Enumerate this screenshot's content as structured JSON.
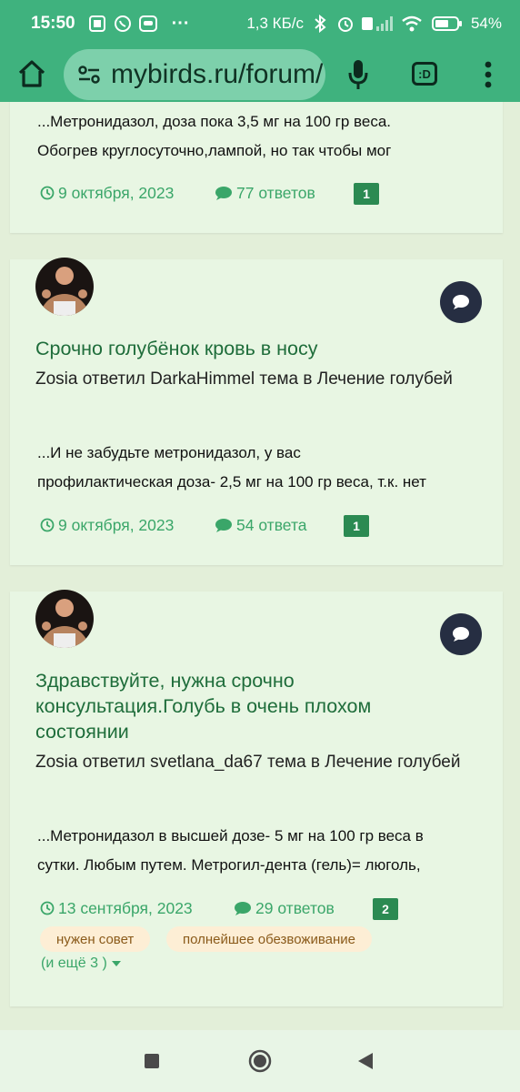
{
  "status_bar": {
    "time": "15:50",
    "speed": "1,3 КБ/с",
    "battery": "54%",
    "more": "···"
  },
  "browser": {
    "url": "mybirds.ru/forum/",
    "extension_label": ":D"
  },
  "posts": [
    {
      "snippet_lines": [
        "...Метронидазол, доза пока 3,5 мг на 100 гр веса.",
        "Обогрев круглосуточно,лампой, но так чтобы мог"
      ],
      "date": "9 октября, 2023",
      "replies": "77 ответов",
      "count": "1"
    },
    {
      "title": "Срочно голубёнок кровь в носу",
      "meta": "Zosia ответил DarkaHimmel тема в Лечение голубей",
      "snippet_lines": [
        "...И не забудьте метронидазол, у вас",
        "профилактическая доза- 2,5 мг на 100 гр веса, т.к. нет"
      ],
      "date": "9 октября, 2023",
      "replies": "54 ответа",
      "count": "1"
    },
    {
      "title": "Здравствуйте, нужна срочно консультация.Голубь в очень плохом состоянии",
      "meta": "Zosia ответил svetlana_da67 тема в Лечение голубей",
      "snippet_lines": [
        "...Метронидазол в высшей дозе- 5 мг на 100 гр веса в",
        "сутки. Любым путем. Метрогил-дента (гель)= люголь,"
      ],
      "date": "13 сентября, 2023",
      "replies": "29 ответов",
      "count": "2",
      "tags": [
        "нужен совет",
        "полнейшее обезвоживание"
      ],
      "more_tags": "(и ещё 3 )"
    }
  ],
  "colors": {
    "status_bar": "#3fb27e",
    "page_bg": "#e3efd9",
    "card_bg": "#e8f6e3",
    "title_green": "#1f6d3b",
    "meta_green": "#3aa669",
    "badge_green": "#2b8a52",
    "chat_badge": "#262e42",
    "tag_bg": "#fdeed5"
  },
  "icons": [
    "home-icon",
    "site-settings-icon",
    "mic-icon",
    "menu-dots-icon",
    "clock-icon",
    "comment-icon",
    "chat-bubble-icon",
    "caret-down-icon",
    "nav-square-icon",
    "nav-circle-icon",
    "nav-back-icon"
  ]
}
